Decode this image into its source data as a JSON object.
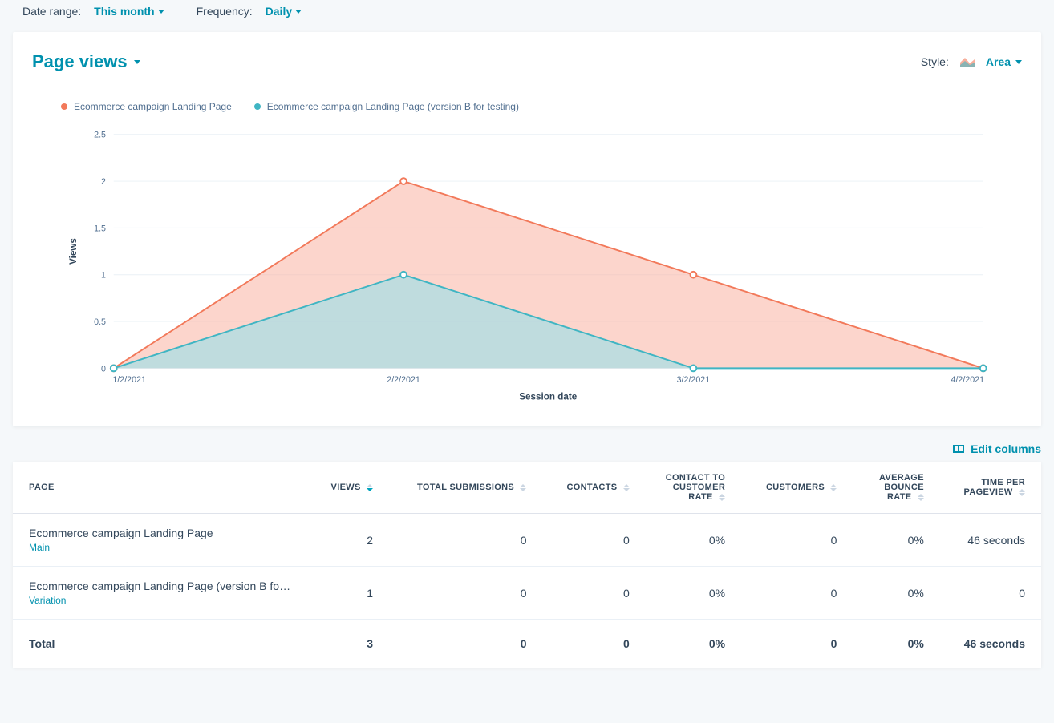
{
  "filters": {
    "date_range_label": "Date range:",
    "date_range_value": "This month",
    "frequency_label": "Frequency:",
    "frequency_value": "Daily"
  },
  "card": {
    "title": "Page views",
    "style_label": "Style:",
    "style_value": "Area"
  },
  "edit_columns_label": "Edit columns",
  "chart_data": {
    "type": "area",
    "xlabel": "Session date",
    "ylabel": "Views",
    "ylim": [
      0,
      2.5
    ],
    "categories": [
      "1/2/2021",
      "2/2/2021",
      "3/2/2021",
      "4/2/2021"
    ],
    "series": [
      {
        "name": "Ecommerce campaign Landing Page",
        "color": "#f2795a",
        "values": [
          0,
          2,
          1,
          0
        ]
      },
      {
        "name": "Ecommerce campaign Landing Page (version B for testing)",
        "color": "#3fb5c3",
        "values": [
          0,
          1,
          0,
          0
        ]
      }
    ],
    "y_ticks": [
      "0",
      "0.5",
      "1",
      "1.5",
      "2",
      "2.5"
    ]
  },
  "table": {
    "headers": {
      "page": "PAGE",
      "views": "VIEWS",
      "total_submissions": "TOTAL SUBMISSIONS",
      "contacts": "CONTACTS",
      "contact_to_customer_rate": "CONTACT TO CUSTOMER RATE",
      "customers": "CUSTOMERS",
      "avg_bounce_rate": "AVERAGE BOUNCE RATE",
      "time_per_pageview": "TIME PER PAGEVIEW"
    },
    "rows": [
      {
        "name": "Ecommerce campaign Landing Page",
        "sub": "Main",
        "views": "2",
        "total_submissions": "0",
        "contacts": "0",
        "contact_to_customer_rate": "0%",
        "customers": "0",
        "avg_bounce_rate": "0%",
        "time_per_pageview": "46 seconds"
      },
      {
        "name": "Ecommerce campaign Landing Page (version B for…",
        "sub": "Variation",
        "views": "1",
        "total_submissions": "0",
        "contacts": "0",
        "contact_to_customer_rate": "0%",
        "customers": "0",
        "avg_bounce_rate": "0%",
        "time_per_pageview": "0"
      }
    ],
    "total": {
      "label": "Total",
      "views": "3",
      "total_submissions": "0",
      "contacts": "0",
      "contact_to_customer_rate": "0%",
      "customers": "0",
      "avg_bounce_rate": "0%",
      "time_per_pageview": "46 seconds"
    }
  }
}
